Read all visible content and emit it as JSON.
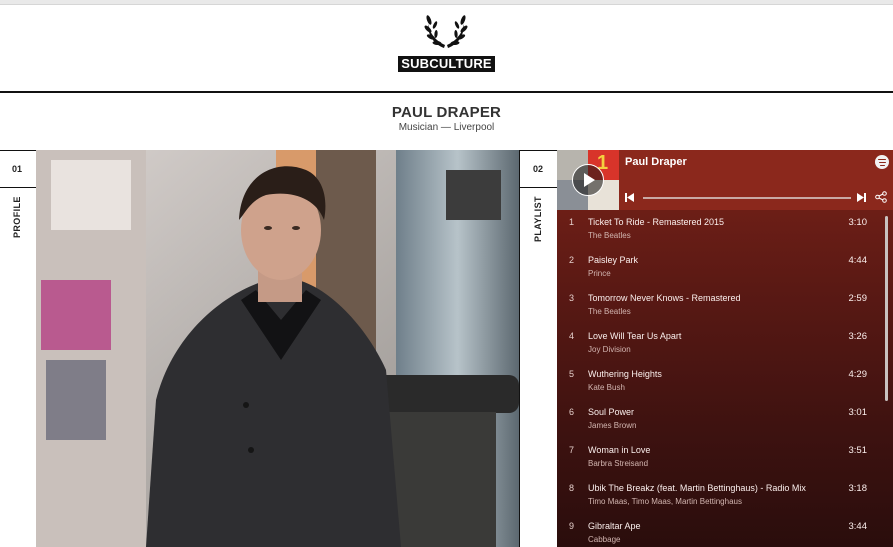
{
  "brand": {
    "name": "SUBCULTURE"
  },
  "person": {
    "name": "PAUL DRAPER",
    "subtitle": "Musician — Liverpool"
  },
  "sections": {
    "profile": {
      "number": "01",
      "label": "PROFILE"
    },
    "playlist": {
      "number": "02",
      "label": "PLAYLIST"
    }
  },
  "player": {
    "title": "Paul Draper",
    "icons": [
      "play-icon",
      "spotify-icon",
      "previous-icon",
      "next-icon",
      "share-icon"
    ],
    "tracks": [
      {
        "num": "1",
        "title": "Ticket To Ride - Remastered 2015",
        "artist": "The Beatles",
        "duration": "3:10"
      },
      {
        "num": "2",
        "title": "Paisley Park",
        "artist": "Prince",
        "duration": "4:44"
      },
      {
        "num": "3",
        "title": "Tomorrow Never Knows - Remastered",
        "artist": "The Beatles",
        "duration": "2:59"
      },
      {
        "num": "4",
        "title": "Love Will Tear Us Apart",
        "artist": "Joy Division",
        "duration": "3:26"
      },
      {
        "num": "5",
        "title": "Wuthering Heights",
        "artist": "Kate Bush",
        "duration": "4:29"
      },
      {
        "num": "6",
        "title": "Soul Power",
        "artist": "James Brown",
        "duration": "3:01"
      },
      {
        "num": "7",
        "title": "Woman in Love",
        "artist": "Barbra Streisand",
        "duration": "3:51"
      },
      {
        "num": "8",
        "title": "Ubik The Breakz (feat. Martin Bettinghaus) - Radio Mix",
        "artist": "Timo Maas, Timo Maas, Martin Bettinghaus",
        "duration": "3:18"
      },
      {
        "num": "9",
        "title": "Gibraltar Ape",
        "artist": "Cabbage",
        "duration": "3:44"
      }
    ]
  }
}
